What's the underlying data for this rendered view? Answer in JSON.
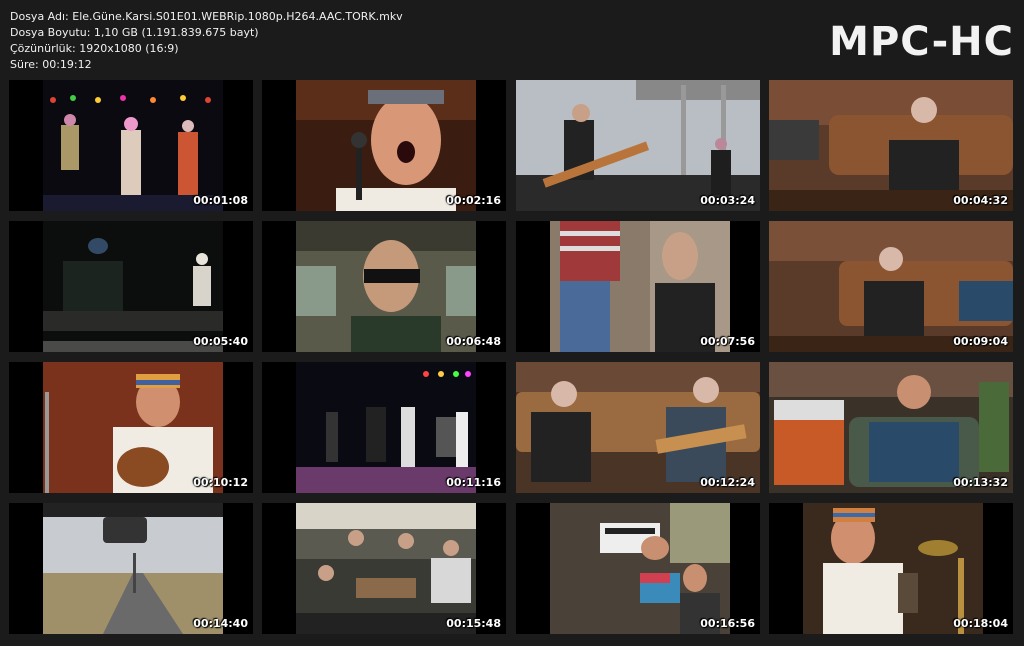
{
  "file_info": {
    "name_line": "Dosya Adı: Ele.Güne.Karsi.S01E01.WEBRip.1080p.H264.AAC.TORK.mkv",
    "size_line": "Dosya Boyutu: 1,10 GB (1.191.839.675 bayt)",
    "resolution_line": "Çözünürlük: 1920x1080 (16:9)",
    "duration_line": "Süre: 00:19:12"
  },
  "brand": "MPC-HC",
  "thumbnails": [
    {
      "time": "00:01:08",
      "scene": "concert-stage-trio"
    },
    {
      "time": "00:02:16",
      "scene": "singer-closeup-headband"
    },
    {
      "time": "00:03:24",
      "scene": "outdoor-stage-guitarists"
    },
    {
      "time": "00:04:32",
      "scene": "man-in-leather-armchair"
    },
    {
      "time": "00:05:40",
      "scene": "dark-stage-keyboard"
    },
    {
      "time": "00:06:48",
      "scene": "bus-man-sunglasses"
    },
    {
      "time": "00:07:56",
      "scene": "two-men-talking"
    },
    {
      "time": "00:09:04",
      "scene": "man-on-couch-microphone"
    },
    {
      "time": "00:10:12",
      "scene": "guitarist-striped-hat"
    },
    {
      "time": "00:11:16",
      "scene": "band-on-stage-lights"
    },
    {
      "time": "00:12:24",
      "scene": "two-men-sofa-guitar"
    },
    {
      "time": "00:13:32",
      "scene": "man-in-armchair-amp"
    },
    {
      "time": "00:14:40",
      "scene": "road-through-windshield"
    },
    {
      "time": "00:15:48",
      "scene": "group-in-bus-lounge"
    },
    {
      "time": "00:16:56",
      "scene": "men-resting-in-bus"
    },
    {
      "time": "00:18:04",
      "scene": "musician-with-drums"
    }
  ]
}
